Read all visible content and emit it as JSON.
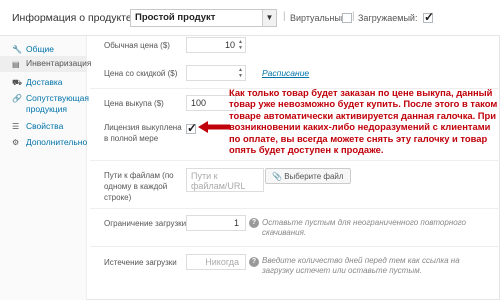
{
  "header": {
    "title": "Информация о продукте —",
    "product_type": "Простой продукт",
    "virtual_label": "Виртуальный:",
    "virtual_checked": false,
    "downloadable_label": "Загружаемый:",
    "downloadable_checked": true
  },
  "sidebar": {
    "items": [
      {
        "label": "Общие",
        "icon": "wrench-icon",
        "active": false
      },
      {
        "label": "Инвентаризация",
        "icon": "inventory-icon",
        "active": true
      },
      {
        "label": "Доставка",
        "icon": "truck-icon",
        "active": false
      },
      {
        "label": "Сопутствующая продукция",
        "icon": "link-icon",
        "active": false
      },
      {
        "label": "Свойства",
        "icon": "list-icon",
        "active": false
      },
      {
        "label": "Дополнительно",
        "icon": "gear-icon",
        "active": false
      }
    ]
  },
  "form": {
    "regular_price_label": "Обычная цена ($)",
    "regular_price_value": "10",
    "sale_price_label": "Цена со скидкой ($)",
    "sale_price_value": "",
    "schedule_link": "Расписание",
    "buyout_price_label": "Цена выкупа ($)",
    "buyout_price_value": "100",
    "license_label": "Лицензия выкуплена в полной мере",
    "license_checked": true,
    "file_paths_label": "Пути к файлам (по одному в каждой строке)",
    "file_paths_placeholder": "Пути к файлам/URL",
    "choose_file_button": "Выберите файл",
    "download_limit_label": "Ограничение загрузки",
    "download_limit_value": "1",
    "download_limit_help": "Оставьте пустым для неограниченного повторного скачивания.",
    "download_expiry_label": "Истечение загрузки",
    "download_expiry_placeholder": "Никогда",
    "download_expiry_help": "Введите количество дней перед тем как ссылка на загрузку истечет или оставьте пустым."
  },
  "annotation": {
    "text": "Как только товар будет заказан по цене выкупа, данный товар уже невозможно будет купить. После этого в таком товаре автоматически активируется данная галочка. При возникновении каких-либо недоразумений с клиентами по оплате, вы всегда можете снять эту галочку и товар опять будет доступен к продаже.",
    "color": "#c0000a"
  }
}
